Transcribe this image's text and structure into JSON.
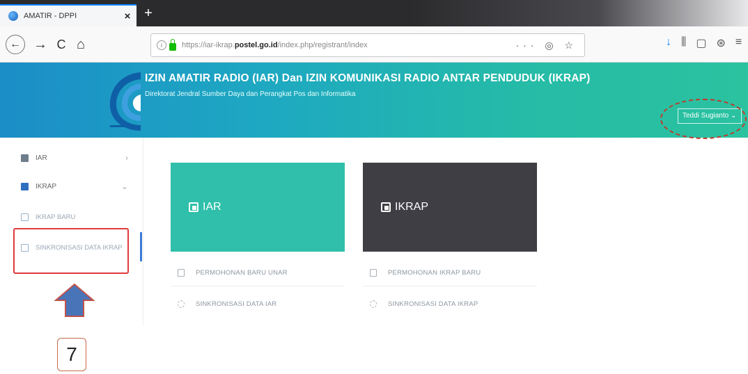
{
  "browser": {
    "tab_title": "AMATIR - DPPI",
    "tab_close": "×",
    "new_tab": "+",
    "url_prefix": "https://iar-ikrap.",
    "url_domain": "postel.go.id",
    "url_path": "/index.php/registrant/index",
    "url_actions": "··· ◎ ☆",
    "toolbar_icons": [
      "↓",
      "⫼",
      "▢",
      "⊛",
      "≡"
    ],
    "nav": {
      "back": "←",
      "forward": "→",
      "reload": "C",
      "home": "⌂"
    }
  },
  "header": {
    "title": "IZIN AMATIR RADIO (IAR) Dan IZIN KOMUNIKASI RADIO ANTAR PENDUDUK (IKRAP)",
    "subtitle": "Direktorat Jendral Sumber Daya dan Perangkat Pos dan Informatika",
    "user_name": "Teddi Sugianto ⌄"
  },
  "sidebar": {
    "items": [
      {
        "label": "IAR",
        "chevron": "›"
      },
      {
        "label": "IKRAP",
        "chevron": "⌄"
      },
      {
        "label": "IKRAP BARU"
      },
      {
        "label": "SINKRONISASI DATA IKRAP"
      }
    ]
  },
  "annotation": {
    "step_number": "7"
  },
  "cards": {
    "iar": {
      "label": "IAR",
      "links": [
        "PERMOHONAN BARU UNAR",
        "SINKRONISASI DATA IAR"
      ]
    },
    "ikrap": {
      "label": "IKRAP",
      "links": [
        "PERMOHONAN IKRAP BARU",
        "SINKRONISASI DATA IKRAP"
      ]
    }
  },
  "colors": {
    "header_gradient_start": "#1b8dc7",
    "header_gradient_end": "#2bc2a0",
    "iar_card": "#2fbfaa",
    "ikrap_card": "#3f3e45",
    "highlight_red": "#e03a3a",
    "arrow_blue": "#4a74b8"
  }
}
